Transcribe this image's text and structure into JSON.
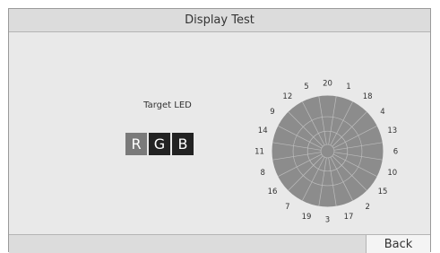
{
  "header": {
    "title": "Display Test"
  },
  "target": {
    "label": "Target LED",
    "rgb": [
      {
        "letter": "R",
        "state": "selected"
      },
      {
        "letter": "G",
        "state": "unselected"
      },
      {
        "letter": "B",
        "state": "unselected"
      }
    ]
  },
  "dial": {
    "numbers_clockwise_from_top": [
      "20",
      "1",
      "18",
      "4",
      "13",
      "6",
      "10",
      "15",
      "2",
      "17",
      "3",
      "19",
      "7",
      "16",
      "8",
      "11",
      "14",
      "9",
      "12",
      "5"
    ],
    "segment_fill": "#8c8c8c",
    "line_color": "#bdbdbd"
  },
  "footer": {
    "back_label": "Back"
  },
  "colors": {
    "background": "#e9e9e9",
    "selected_led": "#7a7a7a",
    "unselected_led": "#222222"
  }
}
